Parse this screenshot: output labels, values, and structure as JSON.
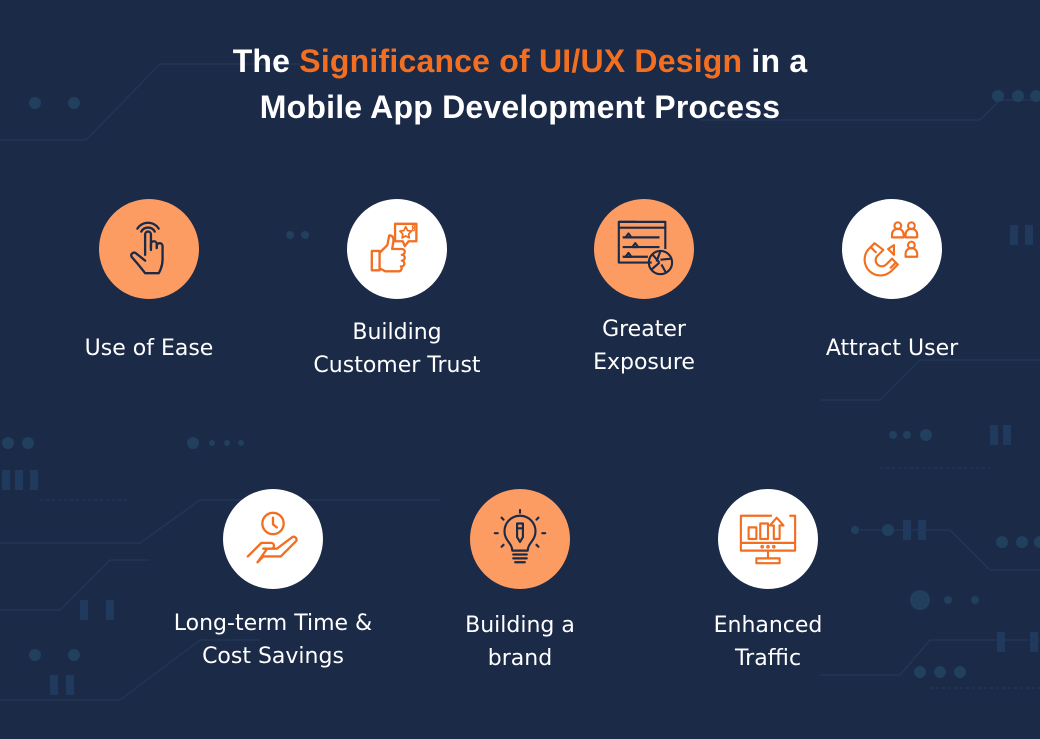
{
  "title": {
    "prefix": "The ",
    "highlight": "Significance of UI/UX Design",
    "suffix": " in a",
    "line2": "Mobile App Development Process"
  },
  "colors": {
    "background": "#1b2a47",
    "accent": "#f26f22",
    "circle_orange": "#fd9c62",
    "circle_white": "#ffffff",
    "icon_dark": "#1b2a47"
  },
  "items": [
    {
      "label": "Use of Ease",
      "icon": "tap-hand-icon",
      "style": "orange"
    },
    {
      "label": "Building\nCustomer Trust",
      "icon": "thumbs-up-review-icon",
      "style": "white"
    },
    {
      "label": "Greater\nExposure",
      "icon": "settings-aperture-icon",
      "style": "orange"
    },
    {
      "label": "Attract User",
      "icon": "magnet-users-icon",
      "style": "white"
    },
    {
      "label": "Long-term Time &\nCost Savings",
      "icon": "hand-clock-icon",
      "style": "white"
    },
    {
      "label": "Building a\nbrand",
      "icon": "idea-bulb-pen-icon",
      "style": "orange"
    },
    {
      "label": "Enhanced\nTraffic",
      "icon": "monitor-growth-icon",
      "style": "white"
    }
  ]
}
